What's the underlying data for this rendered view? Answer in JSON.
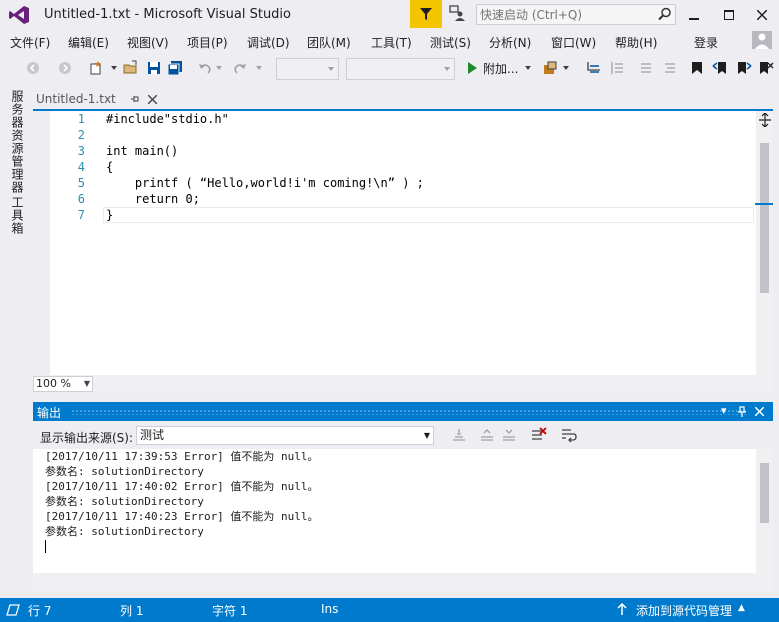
{
  "title_bar": {
    "title": "Untitled-1.txt - Microsoft Visual Studio",
    "quick_launch_placeholder": "快速启动 (Ctrl+Q)"
  },
  "menu": {
    "items": [
      "文件(F)",
      "编辑(E)",
      "视图(V)",
      "项目(P)",
      "调试(D)",
      "团队(M)",
      "工具(T)",
      "测试(S)",
      "分析(N)",
      "窗口(W)",
      "帮助(H)"
    ],
    "login": "登录"
  },
  "toolbar": {
    "attach_label": "附加..."
  },
  "side_tabs": [
    "服务器资源管理器",
    "工具箱"
  ],
  "document": {
    "tab_name": "Untitled-1.txt",
    "lines": [
      {
        "n": "1",
        "text": "#include\"stdio.h\""
      },
      {
        "n": "2",
        "text": ""
      },
      {
        "n": "3",
        "text": "int main()"
      },
      {
        "n": "4",
        "text": "{"
      },
      {
        "n": "5",
        "text": "    printf ( “Hello,world!i'm coming!\\n” ) ;"
      },
      {
        "n": "6",
        "text": "    return 0;"
      },
      {
        "n": "7",
        "text": "}"
      }
    ],
    "zoom": "100 %"
  },
  "output": {
    "title": "输出",
    "source_label": "显示输出来源(S):",
    "source_value": "测试",
    "lines": [
      "[2017/10/11 17:39:53 Error] 值不能为 null。",
      "参数名: solutionDirectory",
      "[2017/10/11 17:40:02 Error] 值不能为 null。",
      "参数名: solutionDirectory",
      "[2017/10/11 17:40:23 Error] 值不能为 null。",
      "参数名: solutionDirectory"
    ]
  },
  "status": {
    "row": "行 7",
    "col": "列 1",
    "char": "字符 1",
    "ins": "Ins",
    "source_control": "添加到源代码管理"
  },
  "colors": {
    "accent": "#007acc",
    "filter_yellow": "#f5c400",
    "line_number": "#2b91af"
  }
}
